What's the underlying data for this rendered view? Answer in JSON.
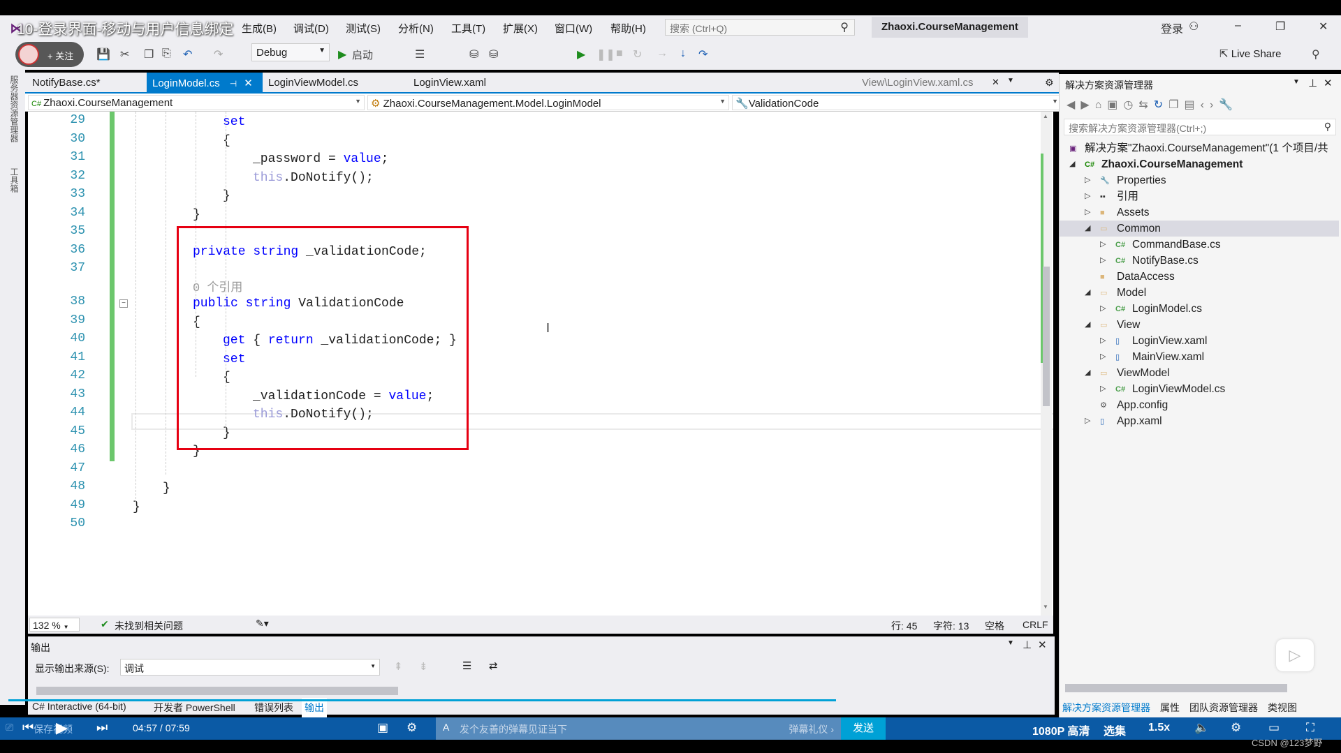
{
  "video_title": "10-登录界面-移动与用户信息绑定",
  "menu": [
    "生成(B)",
    "调试(D)",
    "测试(S)",
    "分析(N)",
    "工具(T)",
    "扩展(X)",
    "窗口(W)",
    "帮助(H)"
  ],
  "search": {
    "placeholder": "搜索 (Ctrl+Q)"
  },
  "solution_name": "Zhaoxi.CourseManagement",
  "account": {
    "login": "登录"
  },
  "toolbar": {
    "follow": "+ 关注",
    "config": "Debug",
    "start": "启动",
    "live_share": "Live Share"
  },
  "left_strip": [
    "服务器资源管理器",
    "工具箱"
  ],
  "tabs": [
    {
      "label": "NotifyBase.cs*",
      "active": false
    },
    {
      "label": "LoginModel.cs",
      "active": true
    },
    {
      "label": "LoginViewModel.cs",
      "active": false
    },
    {
      "label": "LoginView.xaml",
      "active": false
    }
  ],
  "preview_tab": "View\\LoginView.xaml.cs",
  "nav": {
    "project": "Zhaoxi.CourseManagement",
    "class": "Zhaoxi.CourseManagement.Model.LoginModel",
    "member": "ValidationCode"
  },
  "code": [
    {
      "n": "29",
      "i": 3,
      "tk": [
        [
          "kw",
          "set"
        ]
      ]
    },
    {
      "n": "30",
      "i": 3,
      "tk": [
        [
          "pu",
          "{"
        ]
      ]
    },
    {
      "n": "31",
      "i": 4,
      "tk": [
        [
          "id",
          "_password = "
        ],
        [
          "kw",
          "value"
        ],
        [
          "pu",
          ";"
        ]
      ]
    },
    {
      "n": "32",
      "i": 4,
      "tk": [
        [
          "th",
          "this"
        ],
        [
          "pu",
          ".DoNotify();"
        ]
      ]
    },
    {
      "n": "33",
      "i": 3,
      "tk": [
        [
          "pu",
          "}"
        ]
      ]
    },
    {
      "n": "34",
      "i": 2,
      "tk": [
        [
          "pu",
          "}"
        ]
      ]
    },
    {
      "n": "35",
      "i": 2,
      "tk": []
    },
    {
      "n": "36",
      "i": 2,
      "tk": [
        [
          "kw",
          "private string "
        ],
        [
          "id",
          "_validationCode;"
        ]
      ]
    },
    {
      "n": "37",
      "i": 2,
      "tk": [],
      "lens": "0 个引用"
    },
    {
      "n": "38",
      "i": 2,
      "tk": [
        [
          "kw",
          "public string "
        ],
        [
          "id",
          "ValidationCode"
        ]
      ]
    },
    {
      "n": "39",
      "i": 2,
      "tk": [
        [
          "pu",
          "{"
        ]
      ]
    },
    {
      "n": "40",
      "i": 3,
      "tk": [
        [
          "kw",
          "get"
        ],
        [
          "pu",
          " { "
        ],
        [
          "kw",
          "return"
        ],
        [
          "id",
          " _validationCode; }"
        ]
      ]
    },
    {
      "n": "41",
      "i": 3,
      "tk": [
        [
          "kw",
          "set"
        ]
      ]
    },
    {
      "n": "42",
      "i": 3,
      "tk": [
        [
          "pu",
          "{"
        ]
      ]
    },
    {
      "n": "43",
      "i": 4,
      "tk": [
        [
          "id",
          "_validationCode = "
        ],
        [
          "kw",
          "value"
        ],
        [
          "pu",
          ";"
        ]
      ]
    },
    {
      "n": "44",
      "i": 4,
      "tk": [
        [
          "th",
          "this"
        ],
        [
          "pu",
          ".DoNotify();"
        ]
      ]
    },
    {
      "n": "45",
      "i": 3,
      "tk": [
        [
          "pu",
          "}"
        ]
      ]
    },
    {
      "n": "46",
      "i": 2,
      "tk": [
        [
          "pu",
          "}"
        ]
      ]
    },
    {
      "n": "47",
      "i": 2,
      "tk": []
    },
    {
      "n": "48",
      "i": 1,
      "tk": [
        [
          "pu",
          "}"
        ]
      ]
    },
    {
      "n": "49",
      "i": 0,
      "tk": [
        [
          "pu",
          "}"
        ]
      ]
    },
    {
      "n": "50",
      "i": 0,
      "tk": []
    }
  ],
  "status": {
    "zoom": "132 %",
    "issues": "未找到相关问题",
    "line": "行: 45",
    "char": "字符: 13",
    "spaces": "空格",
    "eol": "CRLF"
  },
  "output": {
    "title": "输出",
    "source_label": "显示输出来源(S):",
    "source": "调试"
  },
  "bottom_tabs": [
    "C# Interactive (64-bit)",
    "开发者 PowerShell",
    "错误列表",
    "输出"
  ],
  "solution_explorer": {
    "title": "解决方案资源管理器",
    "search_placeholder": "搜索解决方案资源管理器(Ctrl+;)",
    "items": [
      {
        "label": "解决方案\"Zhaoxi.CourseManagement\"(1 个项目/共",
        "level": 0,
        "exp": "",
        "icon": "solution"
      },
      {
        "label": "Zhaoxi.CourseManagement",
        "level": 0,
        "exp": "open",
        "icon": "csproj",
        "bold": true
      },
      {
        "label": "Properties",
        "level": 1,
        "exp": "closed",
        "icon": "wrench"
      },
      {
        "label": "引用",
        "level": 1,
        "exp": "closed",
        "icon": "reference"
      },
      {
        "label": "Assets",
        "level": 1,
        "exp": "closed",
        "icon": "folder"
      },
      {
        "label": "Common",
        "level": 1,
        "exp": "open",
        "icon": "folder-open",
        "selected": true
      },
      {
        "label": "CommandBase.cs",
        "level": 2,
        "exp": "closed",
        "icon": "cs"
      },
      {
        "label": "NotifyBase.cs",
        "level": 2,
        "exp": "closed",
        "icon": "cs"
      },
      {
        "label": "DataAccess",
        "level": 1,
        "exp": "",
        "icon": "folder"
      },
      {
        "label": "Model",
        "level": 1,
        "exp": "open",
        "icon": "folder-open"
      },
      {
        "label": "LoginModel.cs",
        "level": 2,
        "exp": "closed",
        "icon": "cs"
      },
      {
        "label": "View",
        "level": 1,
        "exp": "open",
        "icon": "folder-open"
      },
      {
        "label": "LoginView.xaml",
        "level": 2,
        "exp": "closed",
        "icon": "xaml"
      },
      {
        "label": "MainView.xaml",
        "level": 2,
        "exp": "closed",
        "icon": "xaml"
      },
      {
        "label": "ViewModel",
        "level": 1,
        "exp": "open",
        "icon": "folder-open"
      },
      {
        "label": "LoginViewModel.cs",
        "level": 2,
        "exp": "closed",
        "icon": "cs"
      },
      {
        "label": "App.config",
        "level": 1,
        "exp": "",
        "icon": "config"
      },
      {
        "label": "App.xaml",
        "level": 1,
        "exp": "closed",
        "icon": "xaml"
      }
    ],
    "bottom_tabs": [
      "解决方案资源管理器",
      "属性",
      "团队资源管理器",
      "类视图"
    ]
  },
  "player": {
    "save": "保存视频",
    "time": "04:57 / 07:59",
    "progress": 0.621,
    "danmu_placeholder": "发个友善的弹幕见证当下",
    "danmu_etiquette": "弹幕礼仪 ›",
    "send": "发送",
    "quality": "1080P 高清",
    "episodes": "选集",
    "speed": "1.5x",
    "watermark": "CSDN @123梦野"
  },
  "colors": {
    "accent": "#007acc",
    "keyword": "#0000ff",
    "line_number": "#2b91af",
    "highlight_box": "#e60012",
    "player": "#0b5aa5"
  }
}
